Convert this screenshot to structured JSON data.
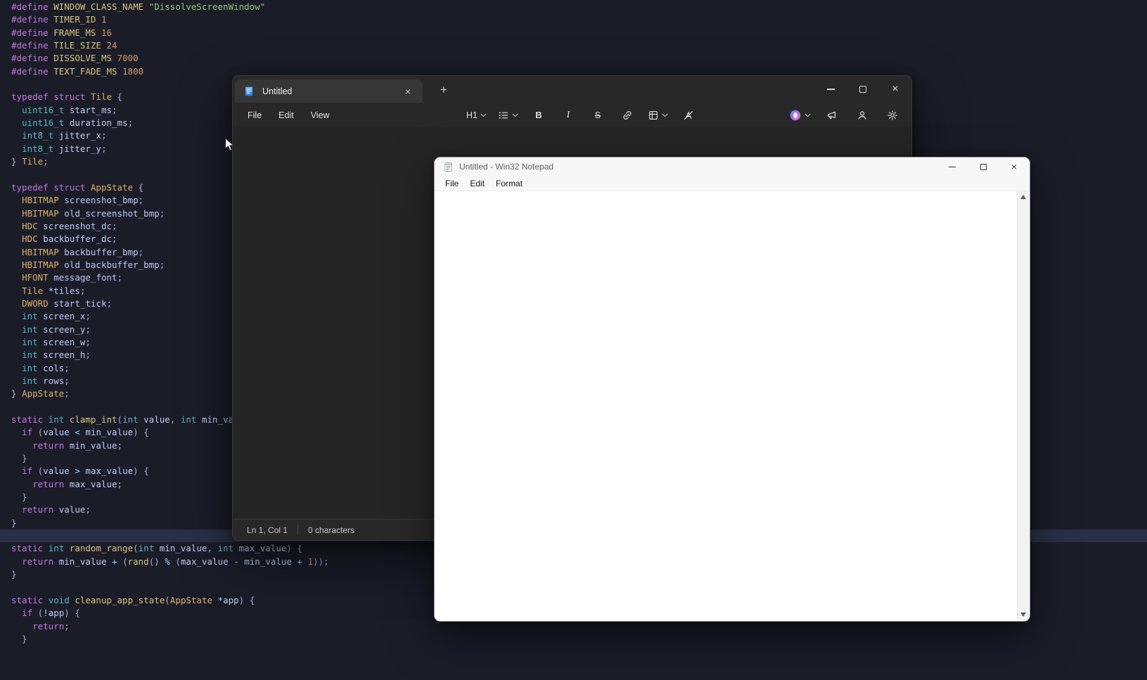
{
  "colors": {
    "editor_bg": "#1a1c28",
    "editor_current_line": "#293046",
    "notepad_chrome": "#282828",
    "notepad_text_area": "#252525",
    "win32_bg": "#ffffff",
    "notepad_icon_blue": "#2a7bd4"
  },
  "glyphs": {
    "close": "×",
    "plus": "+"
  },
  "editor": {
    "cursor_line": 41,
    "lines": [
      [
        [
          "k",
          "#define"
        ],
        [
          "p",
          " "
        ],
        [
          "m",
          "WINDOW_CLASS_NAME"
        ],
        [
          "p",
          " "
        ],
        [
          "s",
          "\"DissolveScreenWindow\""
        ]
      ],
      [
        [
          "k",
          "#define"
        ],
        [
          "p",
          " "
        ],
        [
          "m",
          "TIMER_ID"
        ],
        [
          "p",
          " "
        ],
        [
          "n",
          "1"
        ]
      ],
      [
        [
          "k",
          "#define"
        ],
        [
          "p",
          " "
        ],
        [
          "m",
          "FRAME_MS"
        ],
        [
          "p",
          " "
        ],
        [
          "n",
          "16"
        ]
      ],
      [
        [
          "k",
          "#define"
        ],
        [
          "p",
          " "
        ],
        [
          "m",
          "TILE_SIZE"
        ],
        [
          "p",
          " "
        ],
        [
          "n",
          "24"
        ]
      ],
      [
        [
          "k",
          "#define"
        ],
        [
          "p",
          " "
        ],
        [
          "m",
          "DISSOLVE_MS"
        ],
        [
          "p",
          " "
        ],
        [
          "n",
          "7000"
        ]
      ],
      [
        [
          "k",
          "#define"
        ],
        [
          "p",
          " "
        ],
        [
          "m",
          "TEXT_FADE_MS"
        ],
        [
          "p",
          " "
        ],
        [
          "n",
          "1800"
        ]
      ],
      [],
      [
        [
          "k",
          "typedef"
        ],
        [
          "p",
          " "
        ],
        [
          "k",
          "struct"
        ],
        [
          "p",
          " "
        ],
        [
          "g",
          "Tile"
        ],
        [
          "p",
          " {"
        ]
      ],
      [
        [
          "p",
          "  "
        ],
        [
          "t",
          "uint16_t"
        ],
        [
          "p",
          " "
        ],
        [
          "i",
          "start_ms"
        ],
        [
          "p",
          ";"
        ]
      ],
      [
        [
          "p",
          "  "
        ],
        [
          "t",
          "uint16_t"
        ],
        [
          "p",
          " "
        ],
        [
          "i",
          "duration_ms"
        ],
        [
          "p",
          ";"
        ]
      ],
      [
        [
          "p",
          "  "
        ],
        [
          "t",
          "int8_t"
        ],
        [
          "p",
          " "
        ],
        [
          "i",
          "jitter_x"
        ],
        [
          "p",
          ";"
        ]
      ],
      [
        [
          "p",
          "  "
        ],
        [
          "t",
          "int8_t"
        ],
        [
          "p",
          " "
        ],
        [
          "i",
          "jitter_y"
        ],
        [
          "p",
          ";"
        ]
      ],
      [
        [
          "p",
          "} "
        ],
        [
          "g",
          "Tile"
        ],
        [
          "p",
          ";"
        ]
      ],
      [],
      [
        [
          "k",
          "typedef"
        ],
        [
          "p",
          " "
        ],
        [
          "k",
          "struct"
        ],
        [
          "p",
          " "
        ],
        [
          "g",
          "AppState"
        ],
        [
          "p",
          " {"
        ]
      ],
      [
        [
          "p",
          "  "
        ],
        [
          "g",
          "HBITMAP"
        ],
        [
          "p",
          " "
        ],
        [
          "i",
          "screenshot_bmp"
        ],
        [
          "p",
          ";"
        ]
      ],
      [
        [
          "p",
          "  "
        ],
        [
          "g",
          "HBITMAP"
        ],
        [
          "p",
          " "
        ],
        [
          "i",
          "old_screenshot_bmp"
        ],
        [
          "p",
          ";"
        ]
      ],
      [
        [
          "p",
          "  "
        ],
        [
          "g",
          "HDC"
        ],
        [
          "p",
          " "
        ],
        [
          "i",
          "screenshot_dc"
        ],
        [
          "p",
          ";"
        ]
      ],
      [
        [
          "p",
          "  "
        ],
        [
          "g",
          "HDC"
        ],
        [
          "p",
          " "
        ],
        [
          "i",
          "backbuffer_dc"
        ],
        [
          "p",
          ";"
        ]
      ],
      [
        [
          "p",
          "  "
        ],
        [
          "g",
          "HBITMAP"
        ],
        [
          "p",
          " "
        ],
        [
          "i",
          "backbuffer_bmp"
        ],
        [
          "p",
          ";"
        ]
      ],
      [
        [
          "p",
          "  "
        ],
        [
          "g",
          "HBITMAP"
        ],
        [
          "p",
          " "
        ],
        [
          "i",
          "old_backbuffer_bmp"
        ],
        [
          "p",
          ";"
        ]
      ],
      [
        [
          "p",
          "  "
        ],
        [
          "g",
          "HFONT"
        ],
        [
          "p",
          " "
        ],
        [
          "i",
          "message_font"
        ],
        [
          "p",
          ";"
        ]
      ],
      [
        [
          "p",
          "  "
        ],
        [
          "g",
          "Tile"
        ],
        [
          "p",
          " "
        ],
        [
          "o",
          "*"
        ],
        [
          "i",
          "tiles"
        ],
        [
          "p",
          ";"
        ]
      ],
      [
        [
          "p",
          "  "
        ],
        [
          "g",
          "DWORD"
        ],
        [
          "p",
          " "
        ],
        [
          "i",
          "start_tick"
        ],
        [
          "p",
          ";"
        ]
      ],
      [
        [
          "p",
          "  "
        ],
        [
          "t",
          "int"
        ],
        [
          "p",
          " "
        ],
        [
          "i",
          "screen_x"
        ],
        [
          "p",
          ";"
        ]
      ],
      [
        [
          "p",
          "  "
        ],
        [
          "t",
          "int"
        ],
        [
          "p",
          " "
        ],
        [
          "i",
          "screen_y"
        ],
        [
          "p",
          ";"
        ]
      ],
      [
        [
          "p",
          "  "
        ],
        [
          "t",
          "int"
        ],
        [
          "p",
          " "
        ],
        [
          "i",
          "screen_w"
        ],
        [
          "p",
          ";"
        ]
      ],
      [
        [
          "p",
          "  "
        ],
        [
          "t",
          "int"
        ],
        [
          "p",
          " "
        ],
        [
          "i",
          "screen_h"
        ],
        [
          "p",
          ";"
        ]
      ],
      [
        [
          "p",
          "  "
        ],
        [
          "t",
          "int"
        ],
        [
          "p",
          " "
        ],
        [
          "i",
          "cols"
        ],
        [
          "p",
          ";"
        ]
      ],
      [
        [
          "p",
          "  "
        ],
        [
          "t",
          "int"
        ],
        [
          "p",
          " "
        ],
        [
          "i",
          "rows"
        ],
        [
          "p",
          ";"
        ]
      ],
      [
        [
          "p",
          "} "
        ],
        [
          "g",
          "AppState"
        ],
        [
          "p",
          ";"
        ]
      ],
      [],
      [
        [
          "k",
          "static"
        ],
        [
          "p",
          " "
        ],
        [
          "t",
          "int"
        ],
        [
          "p",
          " "
        ],
        [
          "f",
          "clamp_int"
        ],
        [
          "p",
          "("
        ],
        [
          "t",
          "int"
        ],
        [
          "p",
          " "
        ],
        [
          "i",
          "value"
        ],
        [
          "p",
          ", "
        ],
        [
          "t",
          "int"
        ],
        [
          "p",
          " "
        ],
        [
          "i",
          "min_va"
        ]
      ],
      [
        [
          "p",
          "  "
        ],
        [
          "k",
          "if"
        ],
        [
          "p",
          " ("
        ],
        [
          "i",
          "value"
        ],
        [
          "p",
          " "
        ],
        [
          "o",
          "<"
        ],
        [
          "p",
          " "
        ],
        [
          "i",
          "min_value"
        ],
        [
          "p",
          ") {"
        ]
      ],
      [
        [
          "p",
          "    "
        ],
        [
          "k",
          "return"
        ],
        [
          "p",
          " "
        ],
        [
          "i",
          "min_value"
        ],
        [
          "p",
          ";"
        ]
      ],
      [
        [
          "p",
          "  }"
        ]
      ],
      [
        [
          "p",
          "  "
        ],
        [
          "k",
          "if"
        ],
        [
          "p",
          " ("
        ],
        [
          "i",
          "value"
        ],
        [
          "p",
          " "
        ],
        [
          "o",
          ">"
        ],
        [
          "p",
          " "
        ],
        [
          "i",
          "max_value"
        ],
        [
          "p",
          ") {"
        ]
      ],
      [
        [
          "p",
          "    "
        ],
        [
          "k",
          "return"
        ],
        [
          "p",
          " "
        ],
        [
          "i",
          "max_value"
        ],
        [
          "p",
          ";"
        ]
      ],
      [
        [
          "p",
          "  }"
        ]
      ],
      [
        [
          "p",
          "  "
        ],
        [
          "k",
          "return"
        ],
        [
          "p",
          " "
        ],
        [
          "i",
          "value"
        ],
        [
          "p",
          ";"
        ]
      ],
      [
        [
          "p",
          "}"
        ]
      ],
      [],
      [
        [
          "k",
          "static"
        ],
        [
          "p",
          " "
        ],
        [
          "t",
          "int"
        ],
        [
          "p",
          " "
        ],
        [
          "f",
          "random_range"
        ],
        [
          "p",
          "("
        ],
        [
          "t",
          "int"
        ],
        [
          "p",
          " "
        ],
        [
          "i",
          "min_value"
        ],
        [
          "p",
          ", "
        ],
        [
          "t",
          "int"
        ],
        [
          "p",
          " "
        ],
        [
          "i",
          "max_value"
        ],
        [
          "p",
          ") {"
        ]
      ],
      [
        [
          "p",
          "  "
        ],
        [
          "k",
          "return"
        ],
        [
          "p",
          " "
        ],
        [
          "i",
          "min_value"
        ],
        [
          "p",
          " "
        ],
        [
          "o",
          "+"
        ],
        [
          "p",
          " ("
        ],
        [
          "f",
          "rand"
        ],
        [
          "p",
          "() "
        ],
        [
          "o",
          "%"
        ],
        [
          "p",
          " ("
        ],
        [
          "i",
          "max_value"
        ],
        [
          "p",
          " "
        ],
        [
          "o",
          "-"
        ],
        [
          "p",
          " "
        ],
        [
          "i",
          "min_value"
        ],
        [
          "p",
          " "
        ],
        [
          "o",
          "+"
        ],
        [
          "p",
          " "
        ],
        [
          "n",
          "1"
        ],
        [
          "p",
          "));"
        ]
      ],
      [
        [
          "p",
          "}"
        ]
      ],
      [],
      [
        [
          "k",
          "static"
        ],
        [
          "p",
          " "
        ],
        [
          "t",
          "void"
        ],
        [
          "p",
          " "
        ],
        [
          "f",
          "cleanup_app_state"
        ],
        [
          "p",
          "("
        ],
        [
          "g",
          "AppState"
        ],
        [
          "p",
          " "
        ],
        [
          "o",
          "*"
        ],
        [
          "i",
          "app"
        ],
        [
          "p",
          ") {"
        ]
      ],
      [
        [
          "p",
          "  "
        ],
        [
          "k",
          "if"
        ],
        [
          "p",
          " ("
        ],
        [
          "o",
          "!"
        ],
        [
          "i",
          "app"
        ],
        [
          "p",
          ") {"
        ]
      ],
      [
        [
          "p",
          "    "
        ],
        [
          "k",
          "return"
        ],
        [
          "p",
          ";"
        ]
      ],
      [
        [
          "p",
          "  }"
        ]
      ]
    ]
  },
  "notepad": {
    "tab_title": "Untitled",
    "menus": [
      "File",
      "Edit",
      "View"
    ],
    "toolbar": {
      "heading": "H1",
      "bold": "B",
      "italic": "I",
      "strikethrough": "S"
    },
    "status": {
      "position": "Ln 1, Col 1",
      "characters": "0 characters"
    }
  },
  "win32": {
    "title": "Untitled - Win32 Notepad",
    "menus": [
      "File",
      "Edit",
      "Format"
    ]
  }
}
